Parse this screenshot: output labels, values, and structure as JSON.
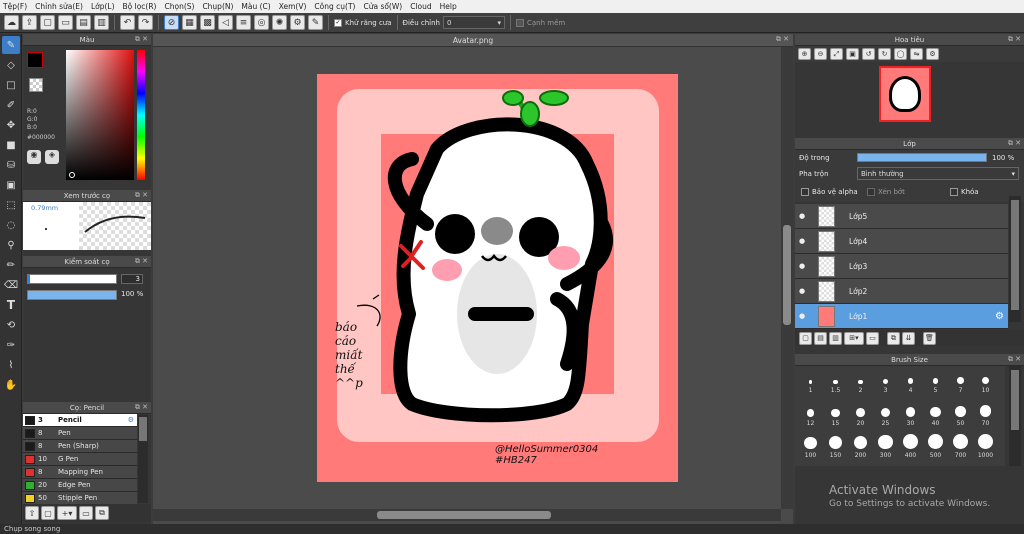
{
  "menu": [
    "Tệp(F)",
    "Chỉnh sửa(E)",
    "Lớp(L)",
    "Bộ lọc(R)",
    "Chọn(S)",
    "Chụp(N)",
    "Màu (C)",
    "Xem(V)",
    "Công cụ(T)",
    "Cửa sổ(W)",
    "Cloud",
    "Help"
  ],
  "toolbar": {
    "antialias_label": "Khử răng cưa",
    "adjust_label": "Điều chỉnh",
    "adjust_value": "0",
    "snap_label": "Cạnh mềm"
  },
  "color_panel": {
    "title": "Màu",
    "r": "R:0",
    "g": "G:0",
    "b": "B:0",
    "hex": "#000000",
    "fg": "#000000",
    "bg": "#ffffff"
  },
  "preview_panel": {
    "title": "Xem trước cọ",
    "size": "0.79mm"
  },
  "brush_control": {
    "title": "Kiểm soát cọ",
    "size_value": "3",
    "opacity_value": "100 %",
    "opacity": 1.0
  },
  "brush_list": {
    "title": "Cọ: Pencil",
    "items": [
      {
        "size": "3",
        "name": "Pencil",
        "color": "#1a1a1a",
        "selected": true
      },
      {
        "size": "8",
        "name": "Pen",
        "color": "#1a1a1a"
      },
      {
        "size": "8",
        "name": "Pen (Sharp)",
        "color": "#1a1a1a"
      },
      {
        "size": "10",
        "name": "G Pen",
        "color": "#e03030"
      },
      {
        "size": "8",
        "name": "Mapping Pen",
        "color": "#e03030"
      },
      {
        "size": "20",
        "name": "Edge Pen",
        "color": "#30b030"
      },
      {
        "size": "50",
        "name": "Stipple Pen",
        "color": "#f0d020"
      }
    ]
  },
  "document": {
    "tab_title": "Avatar.png"
  },
  "artwork": {
    "note_lines": [
      "báo",
      "cáo",
      "miất",
      "thế",
      "^^p"
    ],
    "signature_lines": [
      "@HelloSummer0304",
      "#HB247"
    ]
  },
  "navigator": {
    "title": "Hoa tiêu"
  },
  "layer_panel": {
    "title": "Lớp",
    "opacity_label": "Độ trong",
    "opacity_value": "100 %",
    "opacity": 1.0,
    "blend_label": "Pha trộn",
    "blend_value": "Bình thường",
    "protect_alpha": "Bảo vệ alpha",
    "clipping": "Xén bớt",
    "lock": "Khóa",
    "layers": [
      {
        "name": "Lớp5",
        "selected": false
      },
      {
        "name": "Lớp4",
        "selected": false
      },
      {
        "name": "Lớp3",
        "selected": false
      },
      {
        "name": "Lớp2",
        "selected": false
      },
      {
        "name": "Lớp1",
        "selected": true
      }
    ]
  },
  "brush_size_panel": {
    "title": "Brush Size",
    "sizes": [
      "1",
      "1.5",
      "2",
      "3",
      "4",
      "5",
      "7",
      "10",
      "12",
      "15",
      "20",
      "25",
      "30",
      "40",
      "50",
      "70",
      "100",
      "150",
      "200",
      "300",
      "400",
      "500",
      "700",
      "1000"
    ]
  },
  "watermark": {
    "line1": "Activate Windows",
    "line2": "Go to Settings to activate Windows."
  },
  "statusbar": {
    "text": "Chụp song song"
  },
  "colors": {
    "accent": "#3d7ec9",
    "page_bg": "#ff7a78",
    "panel_pink": "#ffc6c3"
  }
}
